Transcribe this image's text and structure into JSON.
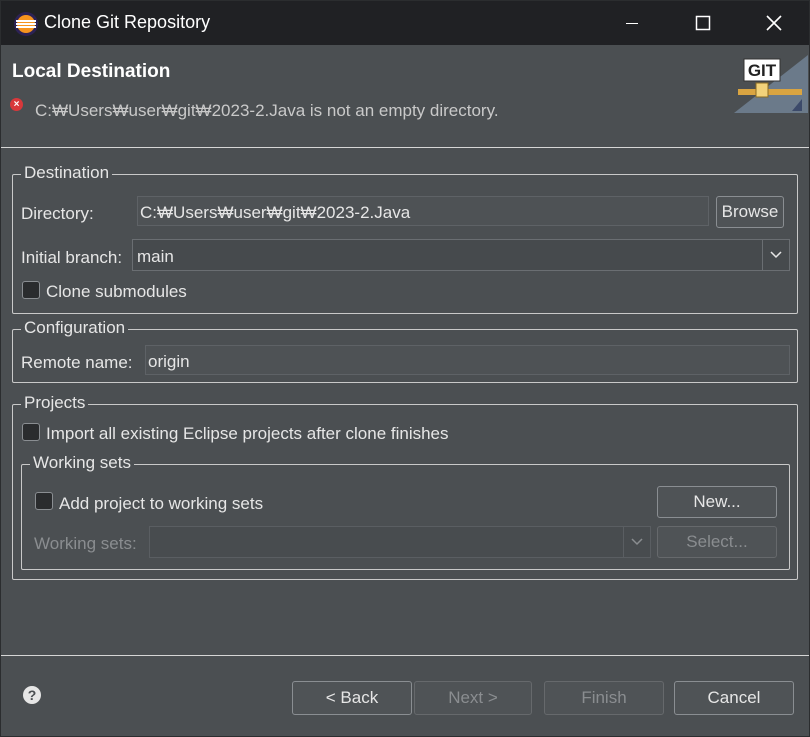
{
  "window": {
    "title": "Clone Git Repository"
  },
  "header": {
    "title": "Local Destination",
    "error_message": "C:₩Users₩user₩git₩2023-2.Java is not an empty directory.",
    "logo_text": "GIT"
  },
  "destination": {
    "group_label": "Destination",
    "directory_label": "Directory:",
    "directory_value": "C:₩Users₩user₩git₩2023-2.Java",
    "browse_label": "Browse",
    "initial_branch_label": "Initial branch:",
    "initial_branch_value": "main",
    "clone_submodules_label": "Clone submodules",
    "clone_submodules_checked": false
  },
  "configuration": {
    "group_label": "Configuration",
    "remote_name_label": "Remote name:",
    "remote_name_value": "origin"
  },
  "projects": {
    "group_label": "Projects",
    "import_label": "Import all existing Eclipse projects after clone finishes",
    "import_checked": false,
    "working_sets": {
      "group_label": "Working sets",
      "add_label": "Add project to working sets",
      "add_checked": false,
      "new_label": "New...",
      "working_sets_label": "Working sets:",
      "working_sets_value": "",
      "select_label": "Select..."
    }
  },
  "footer": {
    "back_label": "< Back",
    "next_label": "Next >",
    "finish_label": "Finish",
    "cancel_label": "Cancel"
  },
  "icons": {
    "app": "eclipse-icon",
    "error": "error-icon",
    "help": "help-icon"
  }
}
